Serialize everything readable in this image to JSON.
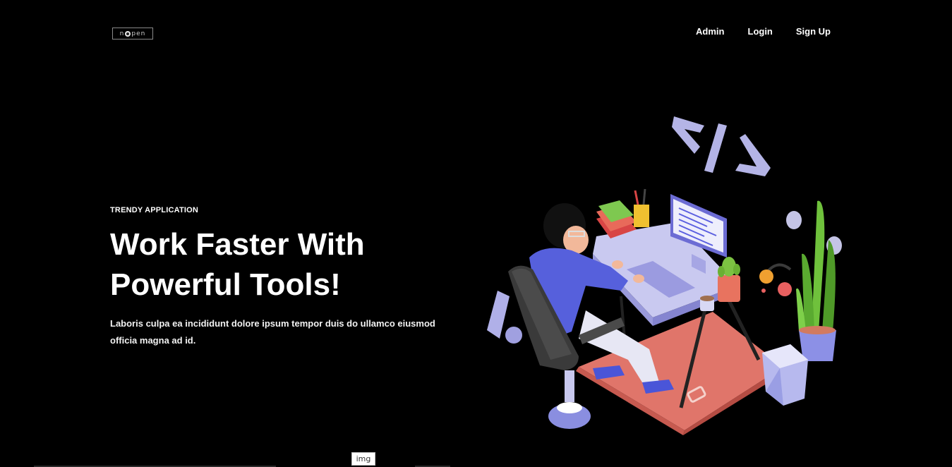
{
  "header": {
    "logo_text_left": "n",
    "logo_text_right": "pen",
    "nav": [
      {
        "label": "Admin"
      },
      {
        "label": "Login"
      },
      {
        "label": "Sign Up"
      }
    ]
  },
  "hero": {
    "eyebrow": "TRENDY APPLICATION",
    "headline_line1": "Work Faster With",
    "headline_line2": "Powerful Tools!",
    "description": "Laboris culpa ea incididunt dolore ipsum tempor duis do ullamco eiusmod officia magna ad id."
  },
  "footer": {
    "img_label": "img"
  },
  "colors": {
    "background": "#000000",
    "text": "#ffffff",
    "accent_purple": "#5b5fe0",
    "rug": "#e07b6e",
    "plant_green": "#6abf3a",
    "code_icon": "#b7b7e8"
  }
}
